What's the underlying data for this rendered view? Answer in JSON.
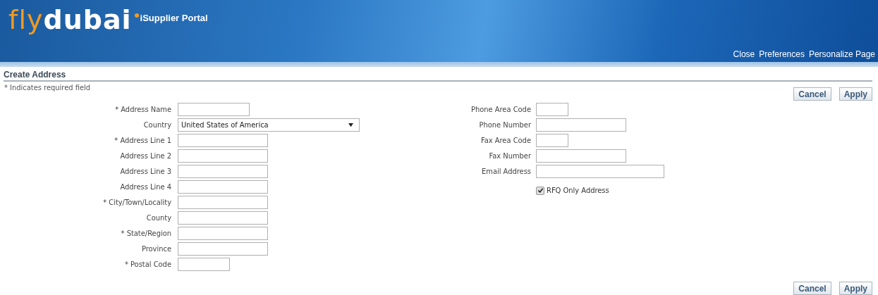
{
  "header": {
    "logo_part1": "fly",
    "logo_part2": "dubai",
    "portal_name": "iSupplier Portal",
    "links": [
      "Close",
      "Preferences",
      "Personalize Page"
    ]
  },
  "page": {
    "title": "Create Address",
    "required_note": "* Indicates required field"
  },
  "buttons_top": [
    "Cancel",
    "Apply"
  ],
  "left_fields": [
    {
      "label": "* Address Name",
      "kind": "medium"
    },
    {
      "label": "Country",
      "kind": "select",
      "value": "United States of America"
    },
    {
      "label": "* Address Line 1",
      "kind": "long"
    },
    {
      "label": "Address Line 2",
      "kind": "long"
    },
    {
      "label": "Address Line 3",
      "kind": "long"
    },
    {
      "label": "Address Line 4",
      "kind": "long"
    },
    {
      "label": "* City/Town/Locality",
      "kind": "long"
    },
    {
      "label": "County",
      "kind": "long"
    },
    {
      "label": "* State/Region",
      "kind": "long"
    },
    {
      "label": "Province",
      "kind": "long"
    },
    {
      "label": "* Postal Code",
      "kind": "short"
    }
  ],
  "right_fields": [
    {
      "label": "Phone Area Code",
      "kind": "tiny"
    },
    {
      "label": "Phone Number",
      "kind": "long"
    },
    {
      "label": "Fax Area Code",
      "kind": "tiny"
    },
    {
      "label": "Fax Number",
      "kind": "long"
    },
    {
      "label": "Email Address",
      "kind": "wide"
    }
  ],
  "rfq_only": {
    "label": "RFQ Only Address",
    "checked": true
  },
  "buttons_bottom": [
    "Cancel",
    "Apply"
  ]
}
